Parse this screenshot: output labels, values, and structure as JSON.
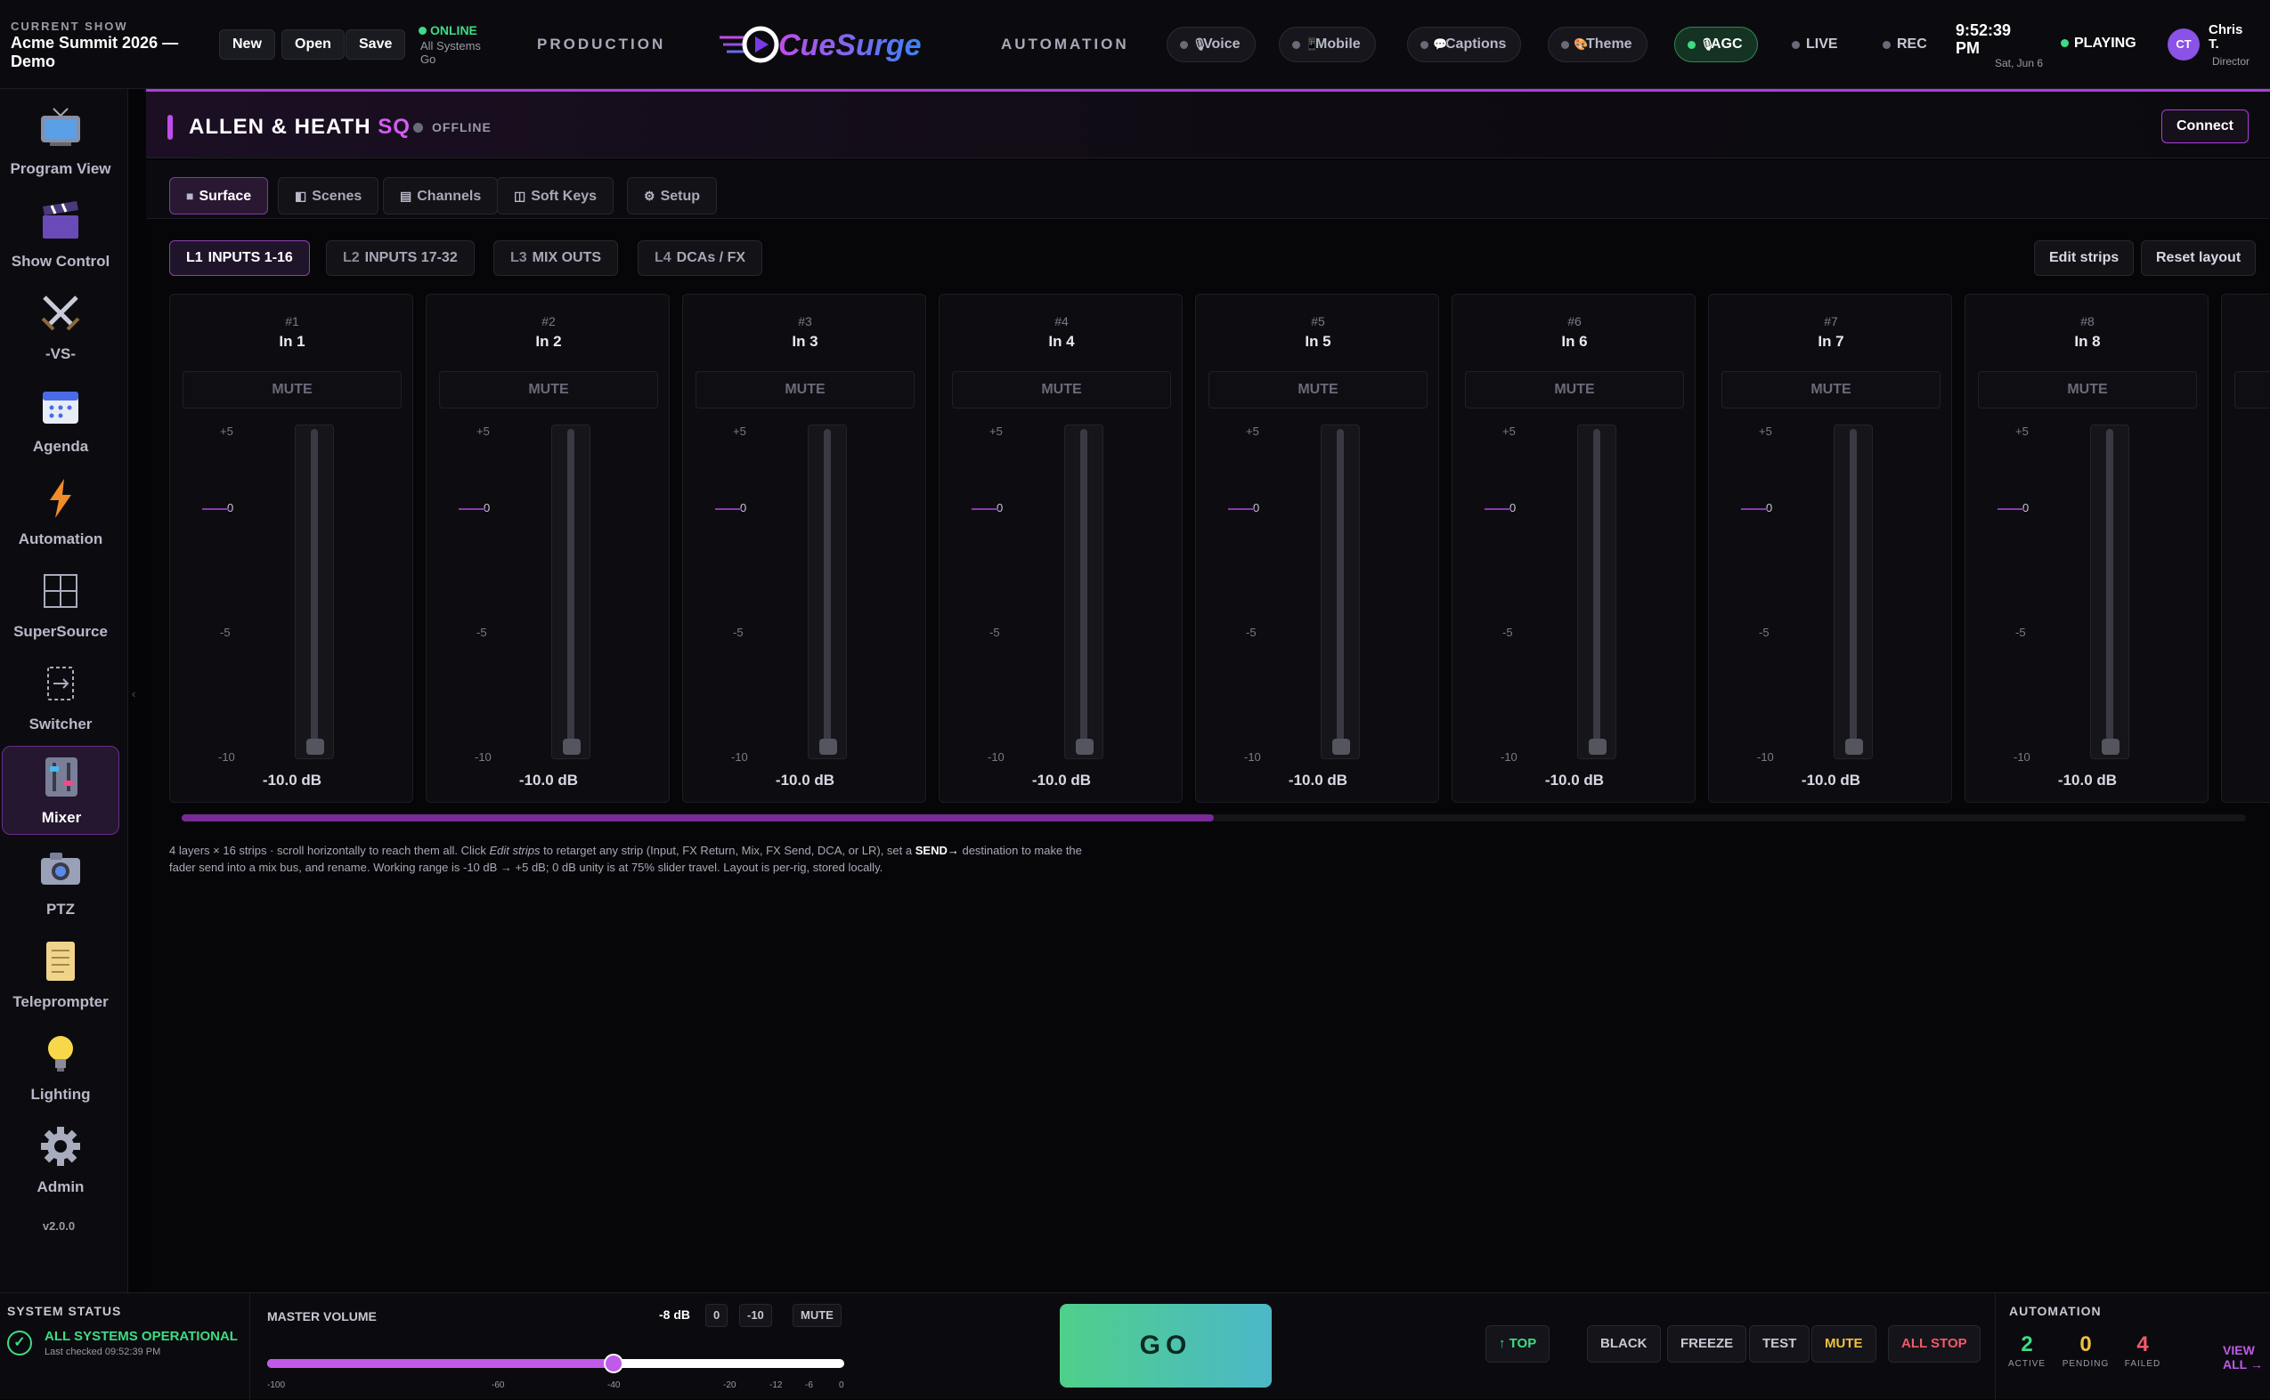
{
  "topbar": {
    "show_label": "CURRENT SHOW",
    "show_title": "Acme Summit 2026 — Demo",
    "new_label": "New",
    "open_label": "Open",
    "save_label": "Save",
    "online_label": "ONLINE",
    "online_sub": "All Systems Go",
    "nav_production": "PRODUCTION",
    "nav_automation": "AUTOMATION",
    "logo_text": "CueSurge",
    "voice_label": "Voice",
    "mobile_label": "Mobile",
    "captions_label": "Captions",
    "theme_label": "Theme",
    "agc_label": "AGC",
    "live_label": "LIVE",
    "rec_label": "REC",
    "clock_time": "9:52:39 PM",
    "clock_date": "Sat, Jun 6",
    "playing_label": "PLAYING",
    "user_initials": "CT",
    "user_name": "Chris T.",
    "user_role": "Director",
    "colors": {
      "accent": "#c04de8",
      "online": "#3ddc84"
    }
  },
  "sidebar": {
    "items": [
      {
        "label": "Program View",
        "icon": "tv-icon"
      },
      {
        "label": "Show Control",
        "icon": "clapperboard-icon"
      },
      {
        "label": "-VS-",
        "icon": "crossed-swords-icon"
      },
      {
        "label": "Agenda",
        "icon": "calendar-icon"
      },
      {
        "label": "Automation",
        "icon": "lightning-icon"
      },
      {
        "label": "SuperSource",
        "icon": "grid-icon"
      },
      {
        "label": "Switcher",
        "icon": "switch-icon"
      },
      {
        "label": "Mixer",
        "icon": "mixer-icon"
      },
      {
        "label": "PTZ",
        "icon": "camera-icon"
      },
      {
        "label": "Teleprompter",
        "icon": "scroll-icon"
      },
      {
        "label": "Lighting",
        "icon": "lightbulb-icon"
      },
      {
        "label": "Admin",
        "icon": "gear-icon"
      }
    ],
    "active": "Mixer",
    "version": "v2.0.0"
  },
  "mixer": {
    "title_main": "ALLEN & HEATH",
    "title_model": "SQ",
    "status": "OFFLINE",
    "connect_label": "Connect",
    "tabs": [
      {
        "label": "Surface",
        "icon": "square-icon"
      },
      {
        "label": "Scenes",
        "icon": "scenes-icon"
      },
      {
        "label": "Channels",
        "icon": "list-icon"
      },
      {
        "label": "Soft Keys",
        "icon": "keys-icon"
      },
      {
        "label": "Setup",
        "icon": "gear-icon"
      }
    ],
    "layers": [
      {
        "code": "L1",
        "label": "INPUTS 1-16"
      },
      {
        "code": "L2",
        "label": "INPUTS 17-32"
      },
      {
        "code": "L3",
        "label": "MIX OUTS"
      },
      {
        "code": "L4",
        "label": "DCAs / FX"
      }
    ],
    "edit_strips_label": "Edit strips",
    "reset_layout_label": "Reset layout",
    "mute_label": "MUTE",
    "scale_labels": [
      "+5",
      "0",
      "-5",
      "-10"
    ],
    "strips": [
      {
        "num": "#1",
        "name": "In 1",
        "db": "-10.0 dB",
        "level": 0
      },
      {
        "num": "#2",
        "name": "In 2",
        "db": "-10.0 dB",
        "level": 0
      },
      {
        "num": "#3",
        "name": "In 3",
        "db": "-10.0 dB",
        "level": 0
      },
      {
        "num": "#4",
        "name": "In 4",
        "db": "-10.0 dB",
        "level": 0
      },
      {
        "num": "#5",
        "name": "In 5",
        "db": "-10.0 dB",
        "level": 0
      },
      {
        "num": "#6",
        "name": "In 6",
        "db": "-10.0 dB",
        "level": 0
      },
      {
        "num": "#7",
        "name": "In 7",
        "db": "-10.0 dB",
        "level": 0
      },
      {
        "num": "#8",
        "name": "In 8",
        "db": "-10.0 dB",
        "level": 0
      }
    ],
    "scroll_fraction": 0.5,
    "help_text_1": "4 layers × 16 strips · scroll horizontally to reach them all. Click ",
    "help_em": "Edit strips",
    "help_text_2": " to retarget any strip (Input, FX Return, Mix, FX Send, DCA, or LR), set a ",
    "help_strong": "SEND→",
    "help_text_3": " destination to make the fader send into a mix bus, and rename. Working range is -10 dB → +5 dB; 0 dB unity is at 75% slider travel. Layout is per-rig, stored locally."
  },
  "footer": {
    "system_status_label": "SYSTEM STATUS",
    "system_ok": "ALL SYSTEMS OPERATIONAL",
    "system_checked": "Last checked 09:52:39 PM",
    "master_label": "MASTER VOLUME",
    "master_value": "-8 dB",
    "chip_zero": "0",
    "chip_minus10": "-10",
    "chip_mute": "MUTE",
    "master_fraction": 0.6,
    "volume_scale": [
      "-100",
      "-60",
      "-40",
      "-20",
      "-12",
      "-6",
      "0"
    ],
    "go_label": "GO",
    "top_label": "↑ TOP",
    "black_label": "BLACK",
    "freeze_label": "FREEZE",
    "test_label": "TEST",
    "mute_label": "MUTE",
    "allstop_label": "ALL STOP",
    "automation_label": "AUTOMATION",
    "active_count": "2",
    "active_label": "ACTIVE",
    "pending_count": "0",
    "pending_label": "PENDING",
    "failed_count": "4",
    "failed_label": "FAILED",
    "view_all_label": "VIEW ALL →"
  }
}
